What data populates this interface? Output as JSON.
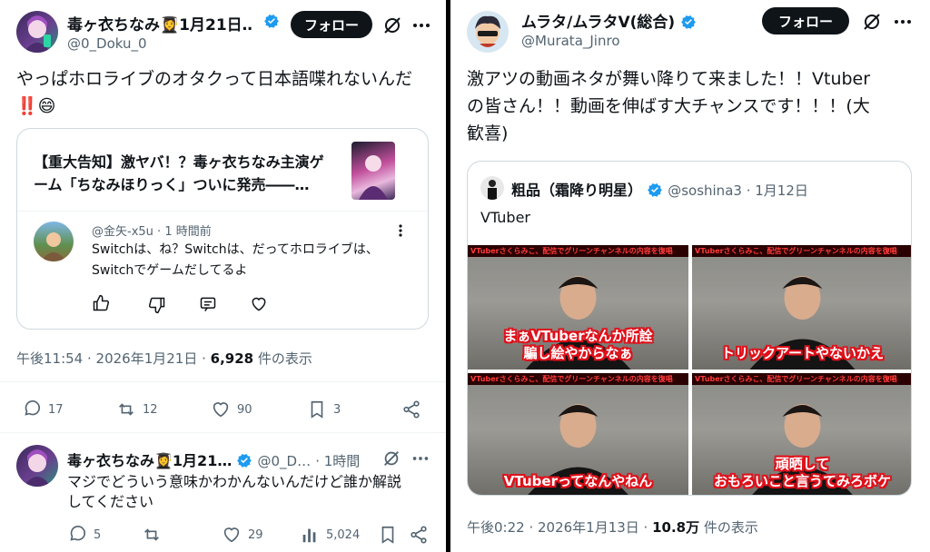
{
  "left": {
    "tweet": {
      "author_name": "毒ヶ衣ちなみ👩‍🎓1月21日…",
      "author_handle": "@0_Doku_0",
      "follow_label": "フォロー",
      "text_line1": "やっぱホロライブのオタクって日本語喋れないんだ",
      "text_line2": "‼️😄",
      "quote": {
        "title_line1": "【重大告知】激ヤバ！？毒ヶ衣ちなみ主演ゲ",
        "title_line2": "ーム「ちなみほりっく」ついに発売――…",
        "reply_handle": "@金矢-x5u",
        "reply_time": "1 時間前",
        "reply_line1": "Switchは、ね？Switchは、だってホロライブは、",
        "reply_line2": "Switchでゲームだしてるよ"
      },
      "timestamp": "午後11:54 · 2026年1月21日 · ",
      "views": "6,928",
      "views_suffix": " 件の表示",
      "replies": "17",
      "retweets": "12",
      "likes": "90",
      "bookmarks": "3"
    },
    "reply": {
      "author_name": "毒ヶ衣ちなみ👩‍🎓1月21…",
      "author_handle": "@0_D…",
      "time": "· 1時間",
      "text_line1": "マジでどういう意味かわかんないんだけど誰か解説",
      "text_line2": "してください",
      "replies": "5",
      "likes": "29",
      "views": "5,024"
    }
  },
  "right": {
    "tweet": {
      "author_name": "ムラタ/ムラタV(総合)",
      "author_handle": "@Murata_Jinro",
      "follow_label": "フォロー",
      "text_line1": "激アツの動画ネタが舞い降りて来ました！！Vtuber",
      "text_line2": "の皆さん！！動画を伸ばす大チャンスです！！！(大",
      "text_line3": "歓喜)",
      "quote": {
        "author_name": "粗品（霜降り明星）",
        "author_handle": "@soshina3 · 1月12日",
        "text": "VTuber",
        "frames": [
          {
            "banner": "VTuberさくらみこ、配信でグリーンチャンネルの内容を復唱",
            "caption1": "まぁVTuberなんか所詮",
            "caption2": "騙し絵やからなぁ"
          },
          {
            "banner": "VTuberさくらみこ、配信でグリーンチャンネルの内容を復唱",
            "caption1": "トリックアートやないかえ",
            "caption2": ""
          },
          {
            "banner": "VTuberさくらみこ、配信でグリーンチャンネルの内容を復唱",
            "caption1": "VTuberってなんやねん",
            "caption2": ""
          },
          {
            "banner": "VTuberさくらみこ、配信でグリーンチャンネルの内容を復唱",
            "caption1": "頑晒して",
            "caption2": "おもろいこと言うてみろボケ"
          }
        ]
      },
      "timestamp": "午後0:22 · 2026年1月13日 · ",
      "views": "10.8万",
      "views_suffix": " 件の表示"
    }
  },
  "colors": {
    "accent": "#1d9bf0",
    "text_secondary": "#536471",
    "caption_red": "#e0101a"
  }
}
